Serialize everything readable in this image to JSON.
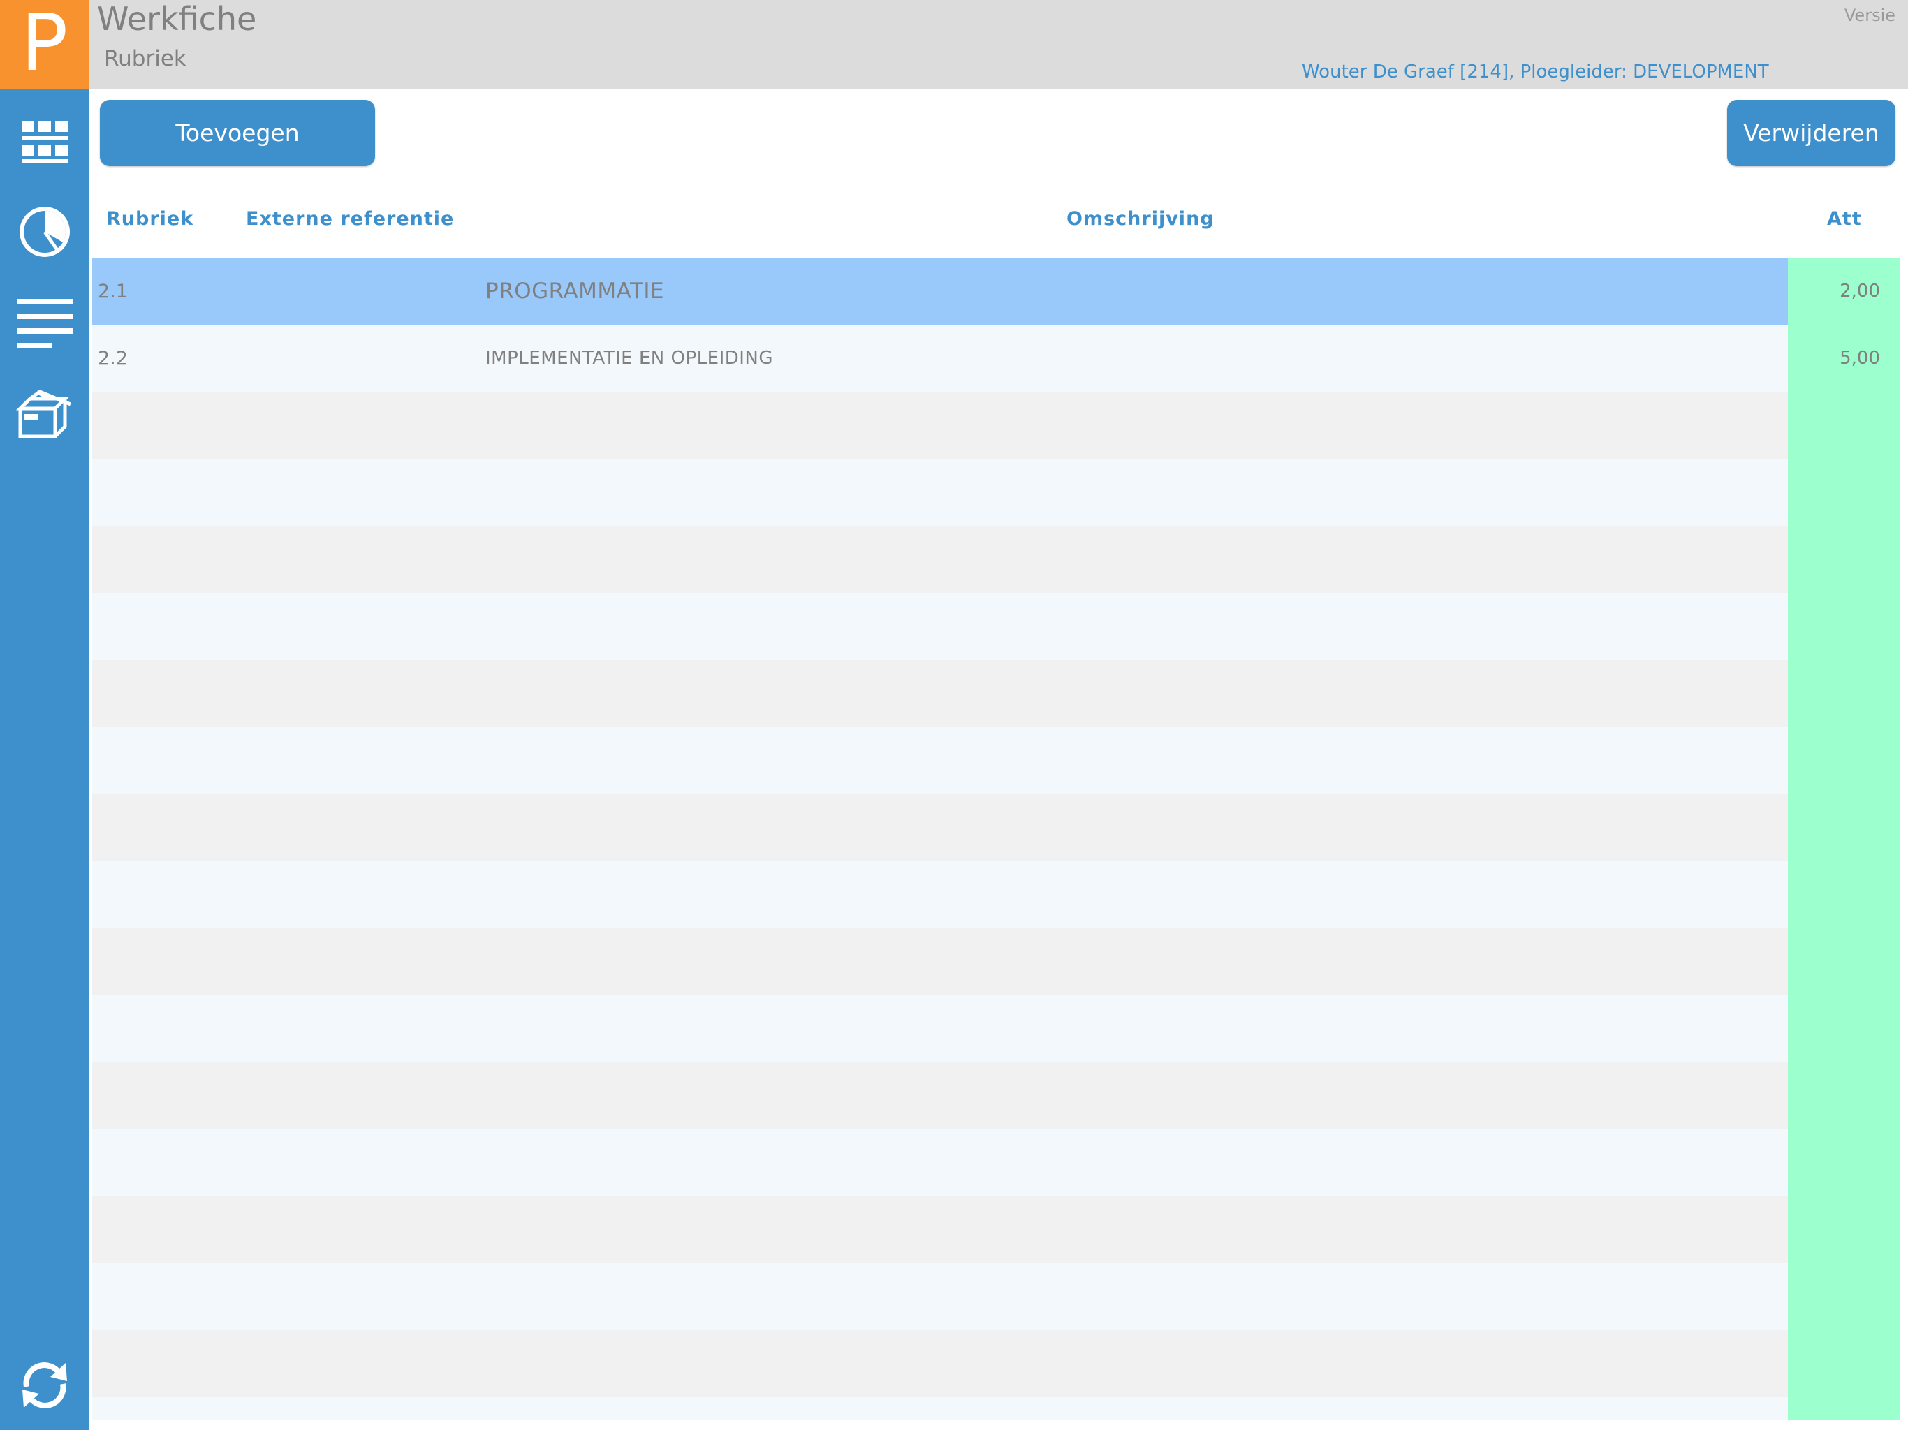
{
  "logo": {
    "letter": "P",
    "color": "#f7922e"
  },
  "header": {
    "title": "Werkfiche",
    "subtitle": "Rubriek",
    "version_label": "Versie",
    "user_info": "Wouter De Graef [214], Ploegleider: DEVELOPMENT"
  },
  "sidebar": {
    "items": [
      {
        "icon": "grid-icon"
      },
      {
        "icon": "clock-icon"
      },
      {
        "icon": "list-icon"
      },
      {
        "icon": "package-icon"
      },
      {
        "icon": "sync-icon"
      }
    ]
  },
  "toolbar": {
    "add_label": "Toevoegen",
    "delete_label": "Verwijderen"
  },
  "table": {
    "columns": {
      "rubriek": "Rubriek",
      "externe_referentie": "Externe referentie",
      "omschrijving": "Omschrijving",
      "att": "Att"
    },
    "rows": [
      {
        "rubriek": "2.1",
        "externe_referentie": "",
        "omschrijving": "PROGRAMMATIE",
        "att": "2,00",
        "selected": true
      },
      {
        "rubriek": "2.2",
        "externe_referentie": "",
        "omschrijving": "IMPLEMENTATIE EN OPLEIDING",
        "att": "5,00",
        "selected": false
      }
    ]
  },
  "colors": {
    "accent": "#3e90cd",
    "header_bg": "#dcdcdc",
    "selected_row": "#99c9fb",
    "att_column": "#9cffce"
  }
}
